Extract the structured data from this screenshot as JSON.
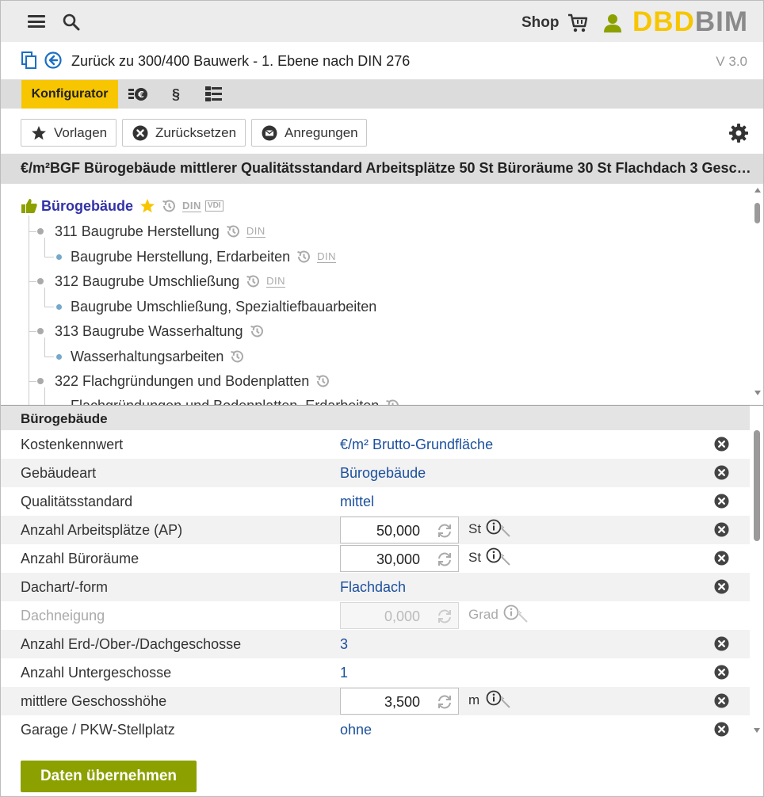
{
  "header": {
    "shop_label": "Shop",
    "logo_part1": "DBD",
    "logo_part2": "BIM",
    "brand_color": "#f7c600"
  },
  "nav": {
    "back_label": "Zurück zu 300/400 Bauwerk - 1. Ebene nach DIN 276",
    "version": "V 3.0"
  },
  "tabs": [
    {
      "label": "Konfigurator",
      "icon": "price-list-icon",
      "active": true
    },
    {
      "label": "",
      "icon": "euro-list-icon"
    },
    {
      "label": "§",
      "icon": "paragraph-icon"
    },
    {
      "label": "",
      "icon": "tree-structure-icon"
    }
  ],
  "toolbar": {
    "vorlagen": "Vorlagen",
    "reset": "Zurücksetzen",
    "anregungen": "Anregungen"
  },
  "summary": "€/m²BGF Bürogebäude mittlerer Qualitätsstandard Arbeitsplätze 50 St Büroräume 30 St Flachdach 3 Geschos…",
  "tree": {
    "root": {
      "label": "Bürogebäude",
      "tags": [
        "DIN",
        "VDI"
      ]
    },
    "items": [
      {
        "label": "311 Baugrube Herstellung",
        "level": 1,
        "din": "DIN"
      },
      {
        "label": "Baugrube Herstellung, Erdarbeiten",
        "level": 2,
        "din": "DIN"
      },
      {
        "label": "312 Baugrube Umschließung",
        "level": 1,
        "din": "DIN"
      },
      {
        "label": "Baugrube Umschließung, Spezialtiefbauarbeiten",
        "level": 2,
        "din": ""
      },
      {
        "label": "313 Baugrube Wasserhaltung",
        "level": 1,
        "din": ""
      },
      {
        "label": "Wasserhaltungsarbeiten",
        "level": 2,
        "din": ""
      },
      {
        "label": "322 Flachgründungen und Bodenplatten",
        "level": 1,
        "din": ""
      },
      {
        "label": "Flachgründungen und Bodenplatten, Erdarbeiten",
        "level": 2,
        "din": ""
      }
    ]
  },
  "properties": {
    "title": "Bürogebäude",
    "rows": [
      {
        "label": "Kostenkennwert",
        "value": "€/m² Brutto-Grundfläche"
      },
      {
        "label": "Gebäudeart",
        "value": "Bürogebäude"
      },
      {
        "label": "Qualitätsstandard",
        "value": "mittel"
      },
      {
        "label": "Anzahl Arbeitsplätze (AP)",
        "input": "50,000",
        "unit": "St"
      },
      {
        "label": "Anzahl Büroräume",
        "input": "30,000",
        "unit": "St"
      },
      {
        "label": "Dachart/-form",
        "value": "Flachdach"
      },
      {
        "label": "Dachneigung",
        "input": "0,000",
        "unit": "Grad",
        "disabled": true
      },
      {
        "label": "Anzahl Erd-/Ober-/Dachgeschosse",
        "value": "3"
      },
      {
        "label": "Anzahl Untergeschosse",
        "value": "1"
      },
      {
        "label": "mittlere Geschosshöhe",
        "input": "3,500",
        "unit": "m"
      },
      {
        "label": "Garage / PKW-Stellplatz",
        "value": "ohne"
      }
    ]
  },
  "footer": {
    "apply_label": "Daten übernehmen",
    "apply_color": "#8ca000"
  }
}
